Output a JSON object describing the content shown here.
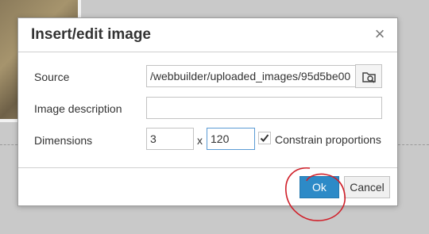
{
  "dialog": {
    "title": "Insert/edit image",
    "close_glyph": "×",
    "source": {
      "label": "Source",
      "value": "/webbuilder/uploaded_images/95d5be00",
      "browse_icon": "browse-folder-icon"
    },
    "description": {
      "label": "Image description",
      "value": ""
    },
    "dimensions": {
      "label": "Dimensions",
      "width": "3",
      "separator": "x",
      "height": "120",
      "constrain_label": "Constrain proportions",
      "constrain_checked": true
    },
    "ok_label": "Ok",
    "cancel_label": "Cancel"
  },
  "colors": {
    "accent": "#2d8ac7",
    "annotation": "#d0202a"
  }
}
